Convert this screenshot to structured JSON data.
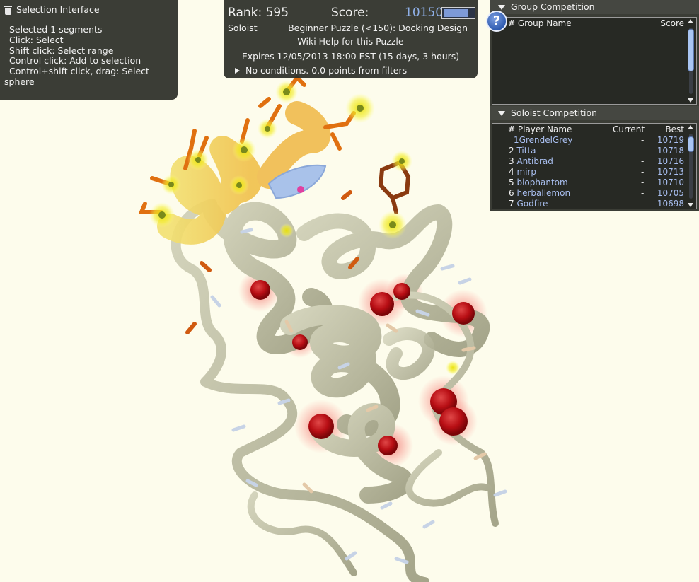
{
  "selection_panel": {
    "title": "Selection Interface",
    "lines": [
      "Selected 1 segments",
      "Click: Select",
      "Shift click: Select range",
      "Control click: Add to selection",
      "Control+shift click, drag: Select",
      "sphere"
    ]
  },
  "score_panel": {
    "rank_text": "Rank: 595",
    "score_label": "Score:",
    "score_value": "10150",
    "score_bar_fraction": 0.88,
    "mode": "Soloist",
    "puzzle_name": "Beginner Puzzle (<150): Docking Design",
    "wiki_help": "Wiki Help for this Puzzle",
    "expires": "Expires 12/05/2013 18:00 EST (15 days, 3 hours)",
    "conditions": "No conditions. 0.0 points from filters"
  },
  "group_competition": {
    "title": "Group Competition",
    "col_rank_name": "# Group Name",
    "col_score": "Score",
    "help_icon": "?"
  },
  "soloist_competition": {
    "title": "Soloist Competition",
    "col_rank_name": "# Player Name",
    "col_current": "Current",
    "col_best": "Best",
    "rows": [
      {
        "rank": "1",
        "name": "GrendelGrey",
        "current": "-",
        "best": "10719"
      },
      {
        "rank": "2",
        "name": "Titta",
        "current": "-",
        "best": "10718"
      },
      {
        "rank": "3",
        "name": "Antibrad",
        "current": "-",
        "best": "10716"
      },
      {
        "rank": "4",
        "name": "mirp",
        "current": "-",
        "best": "10713"
      },
      {
        "rank": "5",
        "name": "biophantom",
        "current": "-",
        "best": "10710"
      },
      {
        "rank": "6",
        "name": "herballemon",
        "current": "-",
        "best": "10705"
      },
      {
        "rank": "7",
        "name": "Godfire",
        "current": "-",
        "best": "10698"
      }
    ]
  },
  "colors": {
    "background": "#fdfcec",
    "panel": "#2c2e28",
    "accent_blue": "#8fb0e8",
    "backbone": "#bcbca2",
    "hydrophobic_ball": "#c8141a",
    "selection_glow": "#f4e300",
    "sidechain_orange": "#e07010",
    "sheet_blue": "#a4bde4"
  }
}
